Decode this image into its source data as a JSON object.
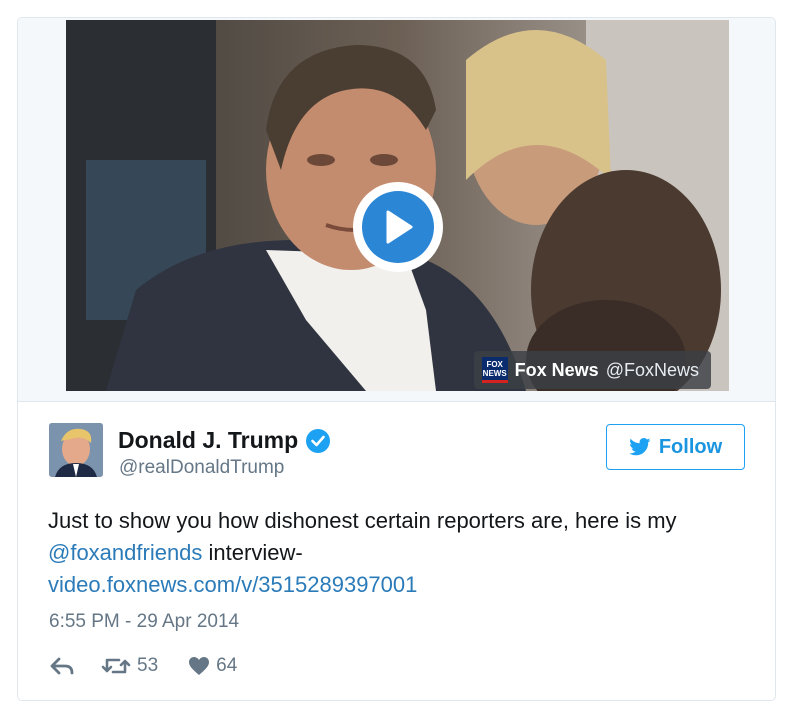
{
  "media": {
    "play_label": "play",
    "attribution": {
      "logo_text_top": "FOX",
      "logo_text_bottom": "NEWS",
      "name": "Fox News",
      "handle": "@FoxNews"
    }
  },
  "author": {
    "name": "Donald J. Trump",
    "handle": "@realDonaldTrump",
    "verified": true
  },
  "follow_button": {
    "label": "Follow"
  },
  "tweet": {
    "text_line1": "Just to show you how dishonest certain reporters are, here is my",
    "mention": "@foxandfriends",
    "text_after_mention": " interview-",
    "link": "video.foxnews.com/v/3515289397001"
  },
  "timestamp": "6:55 PM - 29 Apr 2014",
  "actions": {
    "reply_icon": "reply-icon",
    "retweet_icon": "retweet-icon",
    "retweet_count": "53",
    "like_icon": "heart-icon",
    "like_count": "64"
  },
  "colors": {
    "link": "#2b7bb9",
    "follow_blue": "#1da1f2",
    "play_blue": "#2b86d6",
    "muted_text": "#657786"
  }
}
